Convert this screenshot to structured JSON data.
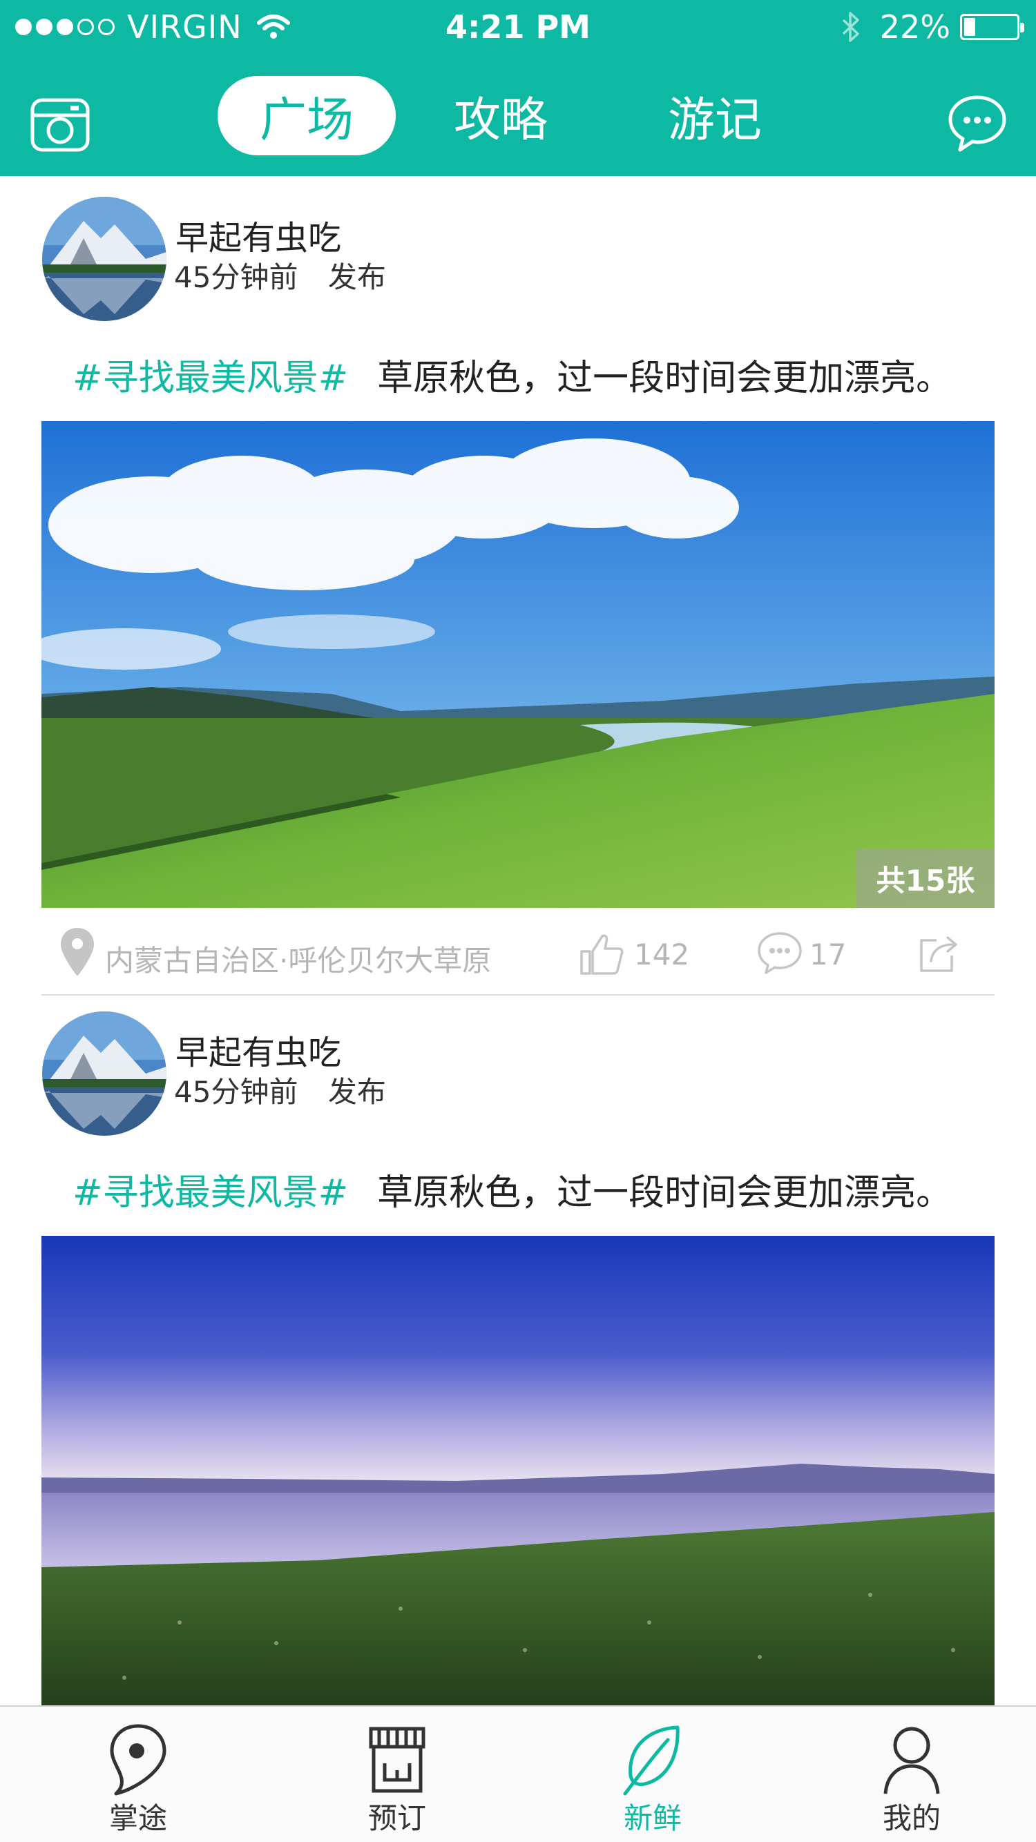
{
  "status_bar": {
    "carrier": "VIRGIN",
    "time": "4:21 PM",
    "battery_percent_text": "22%",
    "battery_level": 0.22
  },
  "header": {
    "tabs": [
      {
        "label": "广场",
        "active": true
      },
      {
        "label": "攻略",
        "active": false
      },
      {
        "label": "游记",
        "active": false
      }
    ],
    "left_icon": "camera-icon",
    "right_icon": "chat-bubble-icon"
  },
  "posts": [
    {
      "user_name": "早起有虫吃",
      "time_ago": "45分钟前",
      "action": "发布",
      "hashtag": "#寻找最美风景#",
      "text": "草原秋色，过一段时间会更加漂亮。",
      "photo_count": "共15张",
      "location": "内蒙古自治区·呼伦贝尔大草原",
      "likes": "142",
      "comments": "17"
    },
    {
      "user_name": "早起有虫吃",
      "time_ago": "45分钟前",
      "action": "发布",
      "hashtag": "#寻找最美风景#",
      "text": "草原秋色，过一段时间会更加漂亮。"
    }
  ],
  "bottom_nav": [
    {
      "label": "掌途",
      "icon": "map-pin-icon",
      "active": false
    },
    {
      "label": "预订",
      "icon": "store-icon",
      "active": false
    },
    {
      "label": "新鲜",
      "icon": "leaf-icon",
      "active": true
    },
    {
      "label": "我的",
      "icon": "person-icon",
      "active": false
    }
  ],
  "colors": {
    "accent": "#0db9a2",
    "inactive_gray": "#b5b5b5",
    "text": "#222222"
  }
}
